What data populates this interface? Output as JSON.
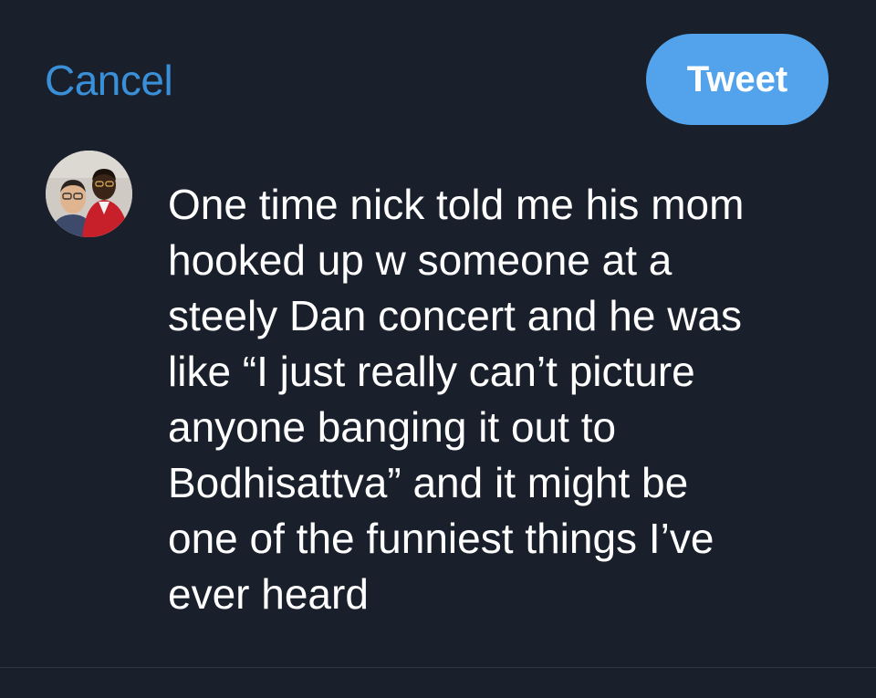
{
  "header": {
    "cancel_label": "Cancel",
    "tweet_label": "Tweet"
  },
  "composer": {
    "avatar": {
      "icon": "profile-photo"
    },
    "tweet_lines": [
      "One time nick told me his mom",
      "hooked up w someone at a",
      "steely Dan concert and he was",
      "like “I just really can’t picture",
      "anyone banging it out to",
      "Bodhisattva” and it might be",
      "one of the funniest things I’ve",
      "ever heard"
    ]
  },
  "colors": {
    "background": "#1a202b",
    "accent": "#3a8fd9",
    "button": "#52a3eb",
    "text": "#ffffff",
    "divider": "#2c3542"
  }
}
